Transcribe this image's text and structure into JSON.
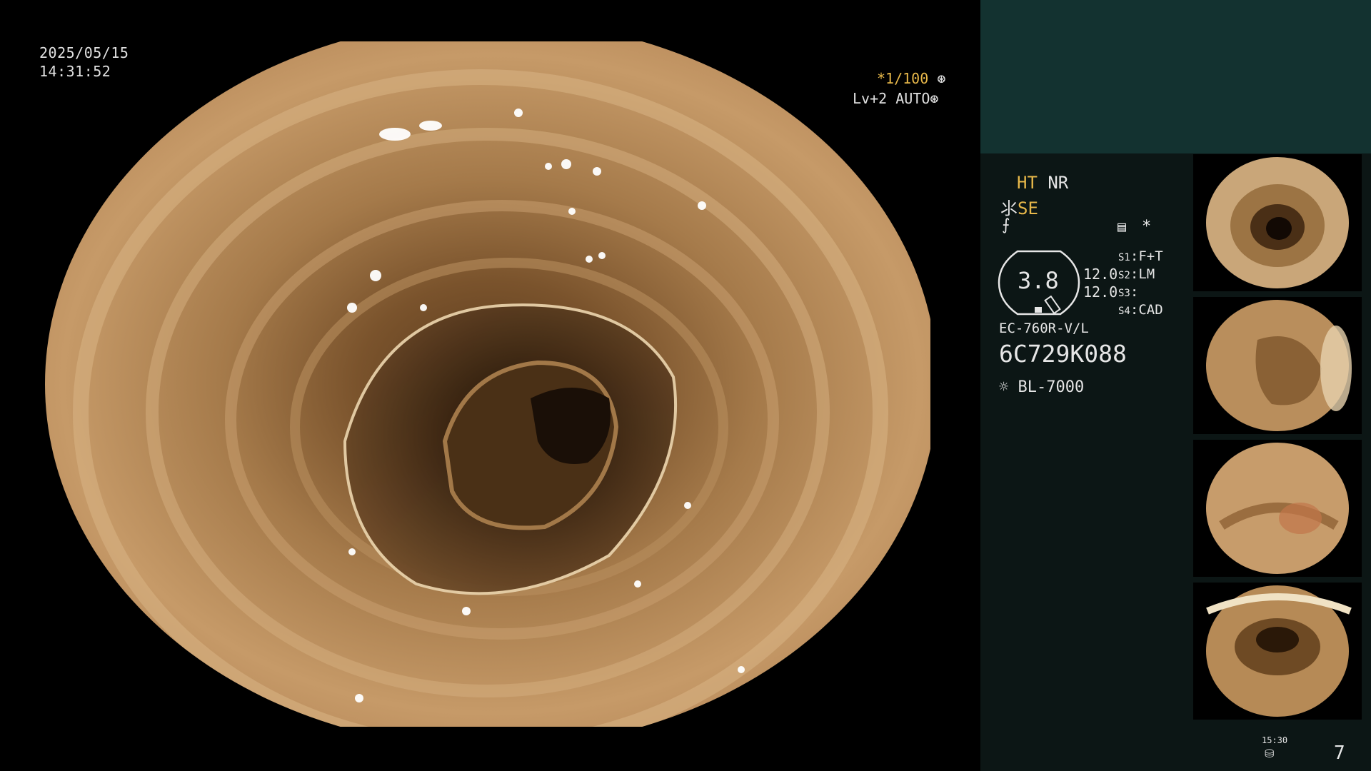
{
  "main": {
    "date": "2025/05/15",
    "time": "14:31:52",
    "shutter_star": "*",
    "shutter": "1/100",
    "level": "Lv+2",
    "iris_mode": "AUTO"
  },
  "panel": {
    "mode_ht": "HT",
    "mode_nr": "NR",
    "se_label": "SE",
    "brightness_value": "3.8",
    "value_a": "12.0",
    "value_b": "12.0",
    "switches": [
      {
        "key": "S1",
        "value": "F+T"
      },
      {
        "key": "S2",
        "value": "LM"
      },
      {
        "key": "S3",
        "value": ""
      },
      {
        "key": "S4",
        "value": "CAD"
      }
    ],
    "star": "*",
    "scope_model": "EC-760R-V/L",
    "scope_serial": "6C729K088",
    "light_source": "BL-7000",
    "storage_time": "15:30",
    "capture_count": "7"
  },
  "colors": {
    "panel_bg": "#0c1615",
    "panel_top": "#133230",
    "accent_yellow": "#e8b84a",
    "mucosa": "#b58a5a"
  }
}
